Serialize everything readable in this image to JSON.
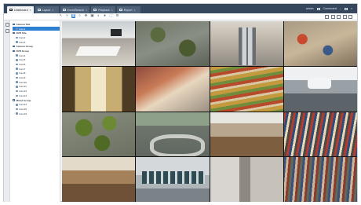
{
  "tabs": [
    {
      "label": "Dashboard",
      "active": true
    },
    {
      "label": "Layout",
      "active": false
    },
    {
      "label": "Event/Search",
      "active": false
    },
    {
      "label": "Playback",
      "active": false
    },
    {
      "label": "Report",
      "active": false
    }
  ],
  "window": {
    "user": "admin",
    "status": "Connected"
  },
  "toolbar": {
    "tools": [
      "cursor-icon",
      "zoom-icon",
      "grid-icon",
      "pan-icon",
      "ptz-icon",
      "snapshot-icon",
      "audio-icon",
      "record-icon",
      "fullscreen-icon",
      "settings-icon"
    ],
    "selected_index": 2,
    "layouts": [
      "layout-1x1-icon",
      "layout-2x2-icon",
      "layout-3x3-icon",
      "layout-4x4-icon",
      "layout-custom-icon"
    ]
  },
  "sidebar": {
    "groups": [
      {
        "label": "Camera Site",
        "children": [
          "Cam1"
        ],
        "selected_child": 0
      },
      {
        "label": "NVR Site",
        "children": [
          "Cam2",
          "Cam3"
        ]
      },
      {
        "label": "Camera Group",
        "children": []
      },
      {
        "label": "NVR Group",
        "children": [
          "Cam4",
          "Cam5",
          "Cam6",
          "Cam7",
          "Cam8",
          "Cam9",
          "Cam10",
          "Cam11",
          "Cam12",
          "Cam13"
        ]
      },
      {
        "label": "Mixed Group",
        "children": [
          "Cam14",
          "Cam15",
          "Cam16"
        ]
      }
    ]
  },
  "grid": {
    "cameras": [
      "Cam 01",
      "Cam 02",
      "Cam 03",
      "Cam 04",
      "Cam 05",
      "Cam 06",
      "Cam 07",
      "Cam 08",
      "Cam 09",
      "Cam 10",
      "Cam 11",
      "Cam 12",
      "Cam 13",
      "Cam 14",
      "Cam 15",
      "Cam 16"
    ]
  },
  "colors": {
    "accent": "#2d7fd1",
    "tabbar": "#35475c"
  }
}
